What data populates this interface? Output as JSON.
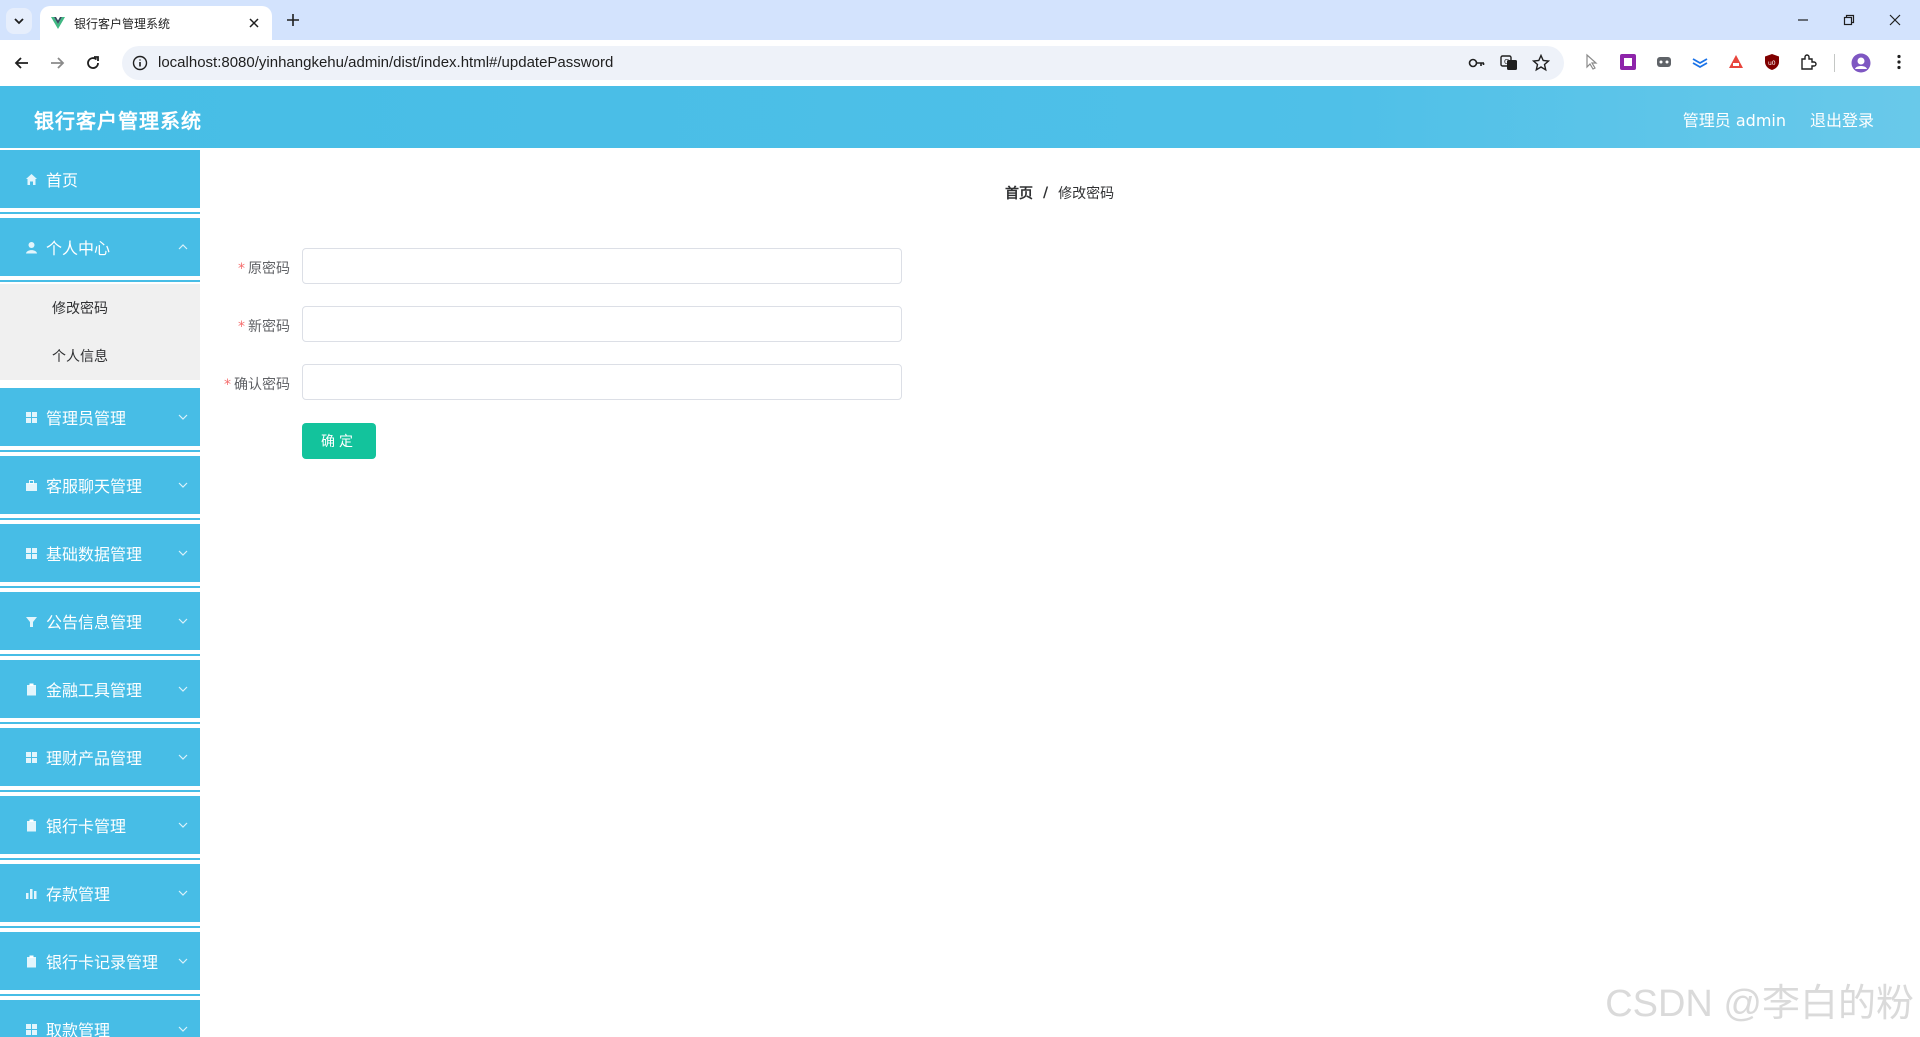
{
  "browser": {
    "tab_title": "银行客户管理系统",
    "url": "localhost:8080/yinhangkehu/admin/dist/index.html#/updatePassword"
  },
  "header": {
    "app_title": "银行客户管理系统",
    "user_label": "管理员 admin",
    "logout_label": "退出登录"
  },
  "sidebar": {
    "items": [
      {
        "label": "首页",
        "icon": "home-icon"
      },
      {
        "label": "个人中心",
        "icon": "user-icon",
        "expanded": true,
        "children": [
          {
            "label": "修改密码"
          },
          {
            "label": "个人信息"
          }
        ]
      },
      {
        "label": "管理员管理",
        "icon": "grid-icon"
      },
      {
        "label": "客服聊天管理",
        "icon": "briefcase-icon"
      },
      {
        "label": "基础数据管理",
        "icon": "grid-icon"
      },
      {
        "label": "公告信息管理",
        "icon": "funnel-icon"
      },
      {
        "label": "金融工具管理",
        "icon": "clipboard-icon"
      },
      {
        "label": "理财产品管理",
        "icon": "grid-icon"
      },
      {
        "label": "银行卡管理",
        "icon": "clipboard-icon"
      },
      {
        "label": "存款管理",
        "icon": "bar-chart-icon"
      },
      {
        "label": "银行卡记录管理",
        "icon": "clipboard-icon"
      },
      {
        "label": "取款管理",
        "icon": "grid-icon"
      }
    ]
  },
  "breadcrumb": {
    "home": "首页",
    "separator": "/",
    "current": "修改密码"
  },
  "form": {
    "required_mark": "*",
    "old_password_label": "原密码",
    "new_password_label": "新密码",
    "confirm_password_label": "确认密码",
    "submit_label": "确定"
  },
  "watermark": "CSDN @李白的粉",
  "colors": {
    "header": "#47bde6",
    "sidebar": "#47bde6",
    "submit": "#13c39c",
    "required": "#f56c6c"
  }
}
